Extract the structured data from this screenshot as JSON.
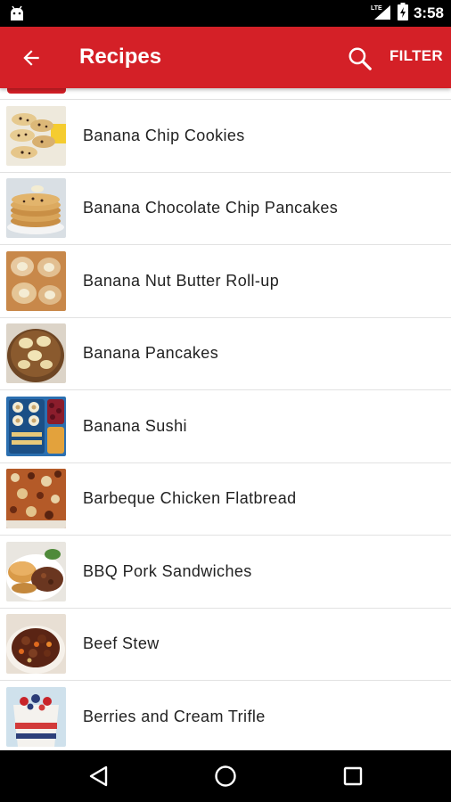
{
  "status_bar": {
    "time": "3:58",
    "network": "LTE",
    "icons": [
      "android-notification-icon",
      "lte-signal-icon",
      "battery-icon"
    ]
  },
  "app_bar": {
    "title": "Recipes",
    "back_icon": "arrow-left-icon",
    "search_icon": "search-icon",
    "filter_label": "FILTER",
    "color": "#d42027"
  },
  "recipes": [
    {
      "name": "Banana Chip Cookies",
      "thumb": "cookies-image"
    },
    {
      "name": "Banana Chocolate Chip Pancakes",
      "thumb": "pancakes-image"
    },
    {
      "name": "Banana Nut Butter Roll-up",
      "thumb": "rollup-image"
    },
    {
      "name": "Banana Pancakes",
      "thumb": "banana-pancakes-image"
    },
    {
      "name": "Banana Sushi",
      "thumb": "sushi-image"
    },
    {
      "name": "Barbeque Chicken Flatbread",
      "thumb": "flatbread-image"
    },
    {
      "name": "BBQ Pork Sandwiches",
      "thumb": "sandwich-image"
    },
    {
      "name": "Beef Stew",
      "thumb": "stew-image"
    },
    {
      "name": "Berries and Cream Trifle",
      "thumb": "trifle-image"
    }
  ],
  "nav_bar": {
    "back": "triangle-back-icon",
    "home": "circle-home-icon",
    "recents": "square-recents-icon"
  }
}
